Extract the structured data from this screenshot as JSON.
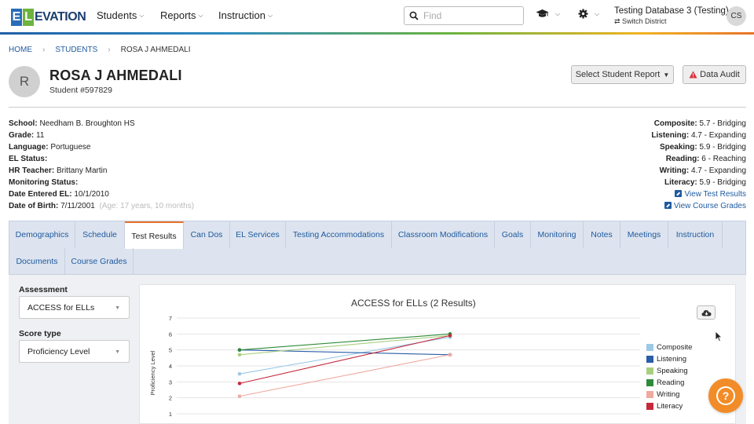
{
  "logo": {
    "letter1": "E",
    "letter2": "L",
    "rest": "EVATION"
  },
  "nav": {
    "students": "Students",
    "reports": "Reports",
    "instruction": "Instruction",
    "search_placeholder": "Find",
    "database": "Testing Database 3 (Testing)",
    "switch_district": "⇄ Switch District",
    "user_initials": "CS"
  },
  "breadcrumb": {
    "home": "HOME",
    "students": "STUDENTS",
    "current": "ROSA J AHMEDALI",
    "sep": "›"
  },
  "student": {
    "initial": "R",
    "name": "ROSA J AHMEDALI",
    "number": "Student #597829"
  },
  "actions": {
    "select_report": "Select Student Report",
    "data_audit": "Data Audit"
  },
  "info": {
    "school_label": "School:",
    "school": " Needham B. Broughton HS",
    "grade_label": "Grade:",
    "grade": " 11",
    "language_label": "Language:",
    "language": " Portuguese",
    "el_status_label": "EL Status:",
    "hr_teacher_label": "HR Teacher:",
    "hr_teacher": " Brittany Martin",
    "monitoring_label": "Monitoring Status:",
    "date_entered_label": "Date Entered EL:",
    "date_entered": " 10/1/2010",
    "dob_label": "Date of Birth:",
    "dob": " 7/11/2001",
    "age": "(Age: 17 years, 10 months)"
  },
  "scores": {
    "composite_label": "Composite:",
    "composite": " 5.7 - Bridging",
    "listening_label": "Listening:",
    "listening": " 4.7 - Expanding",
    "speaking_label": "Speaking:",
    "speaking": " 5.9 - Bridging",
    "reading_label": "Reading:",
    "reading": " 6 - Reaching",
    "writing_label": "Writing:",
    "writing": " 4.7 - Expanding",
    "literacy_label": "Literacy:",
    "literacy": " 5.9 - Bridging",
    "view_test_results": "View Test Results",
    "view_course_grades": "View Course Grades"
  },
  "tabs": {
    "demographics": "Demographics",
    "schedule": "Schedule",
    "test_results": "Test Results",
    "can_dos": "Can Dos",
    "el_services": "EL Services",
    "testing_accommodations": "Testing Accommodations",
    "classroom_modifications": "Classroom Modifications",
    "goals": "Goals",
    "monitoring": "Monitoring",
    "notes": "Notes",
    "meetings": "Meetings",
    "instruction": "Instruction",
    "documents": "Documents",
    "course_grades": "Course Grades"
  },
  "filters": {
    "assessment_label": "Assessment",
    "assessment_value": "ACCESS for ELLs",
    "score_type_label": "Score type",
    "score_type_value": "Proficiency Level"
  },
  "chart_data": {
    "type": "line",
    "title": "ACCESS for ELLs (2 Results)",
    "ylabel": "Proficiency Level",
    "xlabel": "",
    "ylim": [
      0,
      7
    ],
    "yticks": [
      1,
      2,
      3,
      4,
      5,
      6,
      7
    ],
    "legend_position": "right",
    "series": [
      {
        "name": "Composite",
        "color": "#9cc9e6",
        "values": [
          3.5,
          5.8
        ]
      },
      {
        "name": "Listening",
        "color": "#2a5ea8",
        "values": [
          5.0,
          4.7
        ]
      },
      {
        "name": "Speaking",
        "color": "#a8cf7e",
        "values": [
          4.7,
          5.9
        ]
      },
      {
        "name": "Reading",
        "color": "#2e8b3a",
        "values": [
          5.0,
          6.0
        ]
      },
      {
        "name": "Writing",
        "color": "#f0a9a0",
        "values": [
          2.1,
          4.7
        ]
      },
      {
        "name": "Literacy",
        "color": "#c6283c",
        "values": [
          2.9,
          5.9
        ]
      }
    ]
  }
}
